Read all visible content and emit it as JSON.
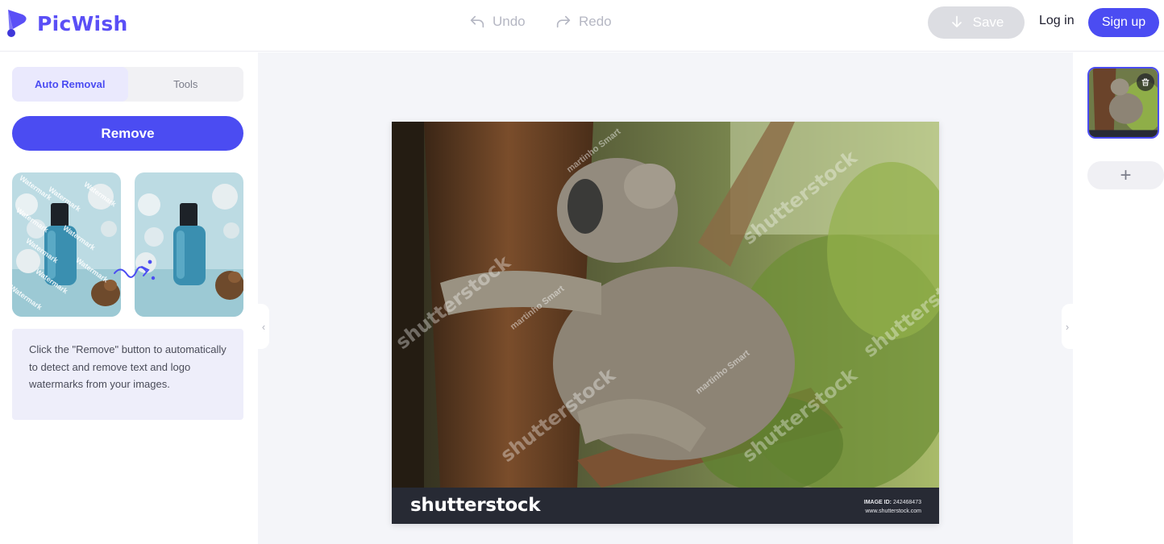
{
  "app": {
    "name": "PicWish",
    "brand_color": "#5a4ff6",
    "accent_color": "#4b4cf2"
  },
  "header": {
    "undo_label": "Undo",
    "redo_label": "Redo",
    "save_label": "Save",
    "login_label": "Log in",
    "signup_label": "Sign up"
  },
  "sidebar": {
    "tabs": [
      {
        "label": "Auto Removal",
        "active": true
      },
      {
        "label": "Tools",
        "active": false
      }
    ],
    "remove_label": "Remove",
    "demo_watermark_text": "Watermark",
    "tip": "Click the \"Remove\" button to automatically to detect and remove text and logo watermarks from your images."
  },
  "image": {
    "watermark_text": "shutterstock",
    "photographer_watermark": "martinho Smart",
    "footer_logo": "shutterstock",
    "image_id_label": "IMAGE ID:",
    "image_id": "242468473",
    "site": "www.shutterstock.com"
  },
  "icons": {
    "undo": "undo-arrow-icon",
    "redo": "redo-arrow-icon",
    "save": "download-icon",
    "trash": "trash-icon",
    "add": "plus-icon",
    "collapse_left": "chevron-left-icon",
    "collapse_right": "chevron-right-icon"
  },
  "right_panel": {
    "add_label": "+"
  }
}
